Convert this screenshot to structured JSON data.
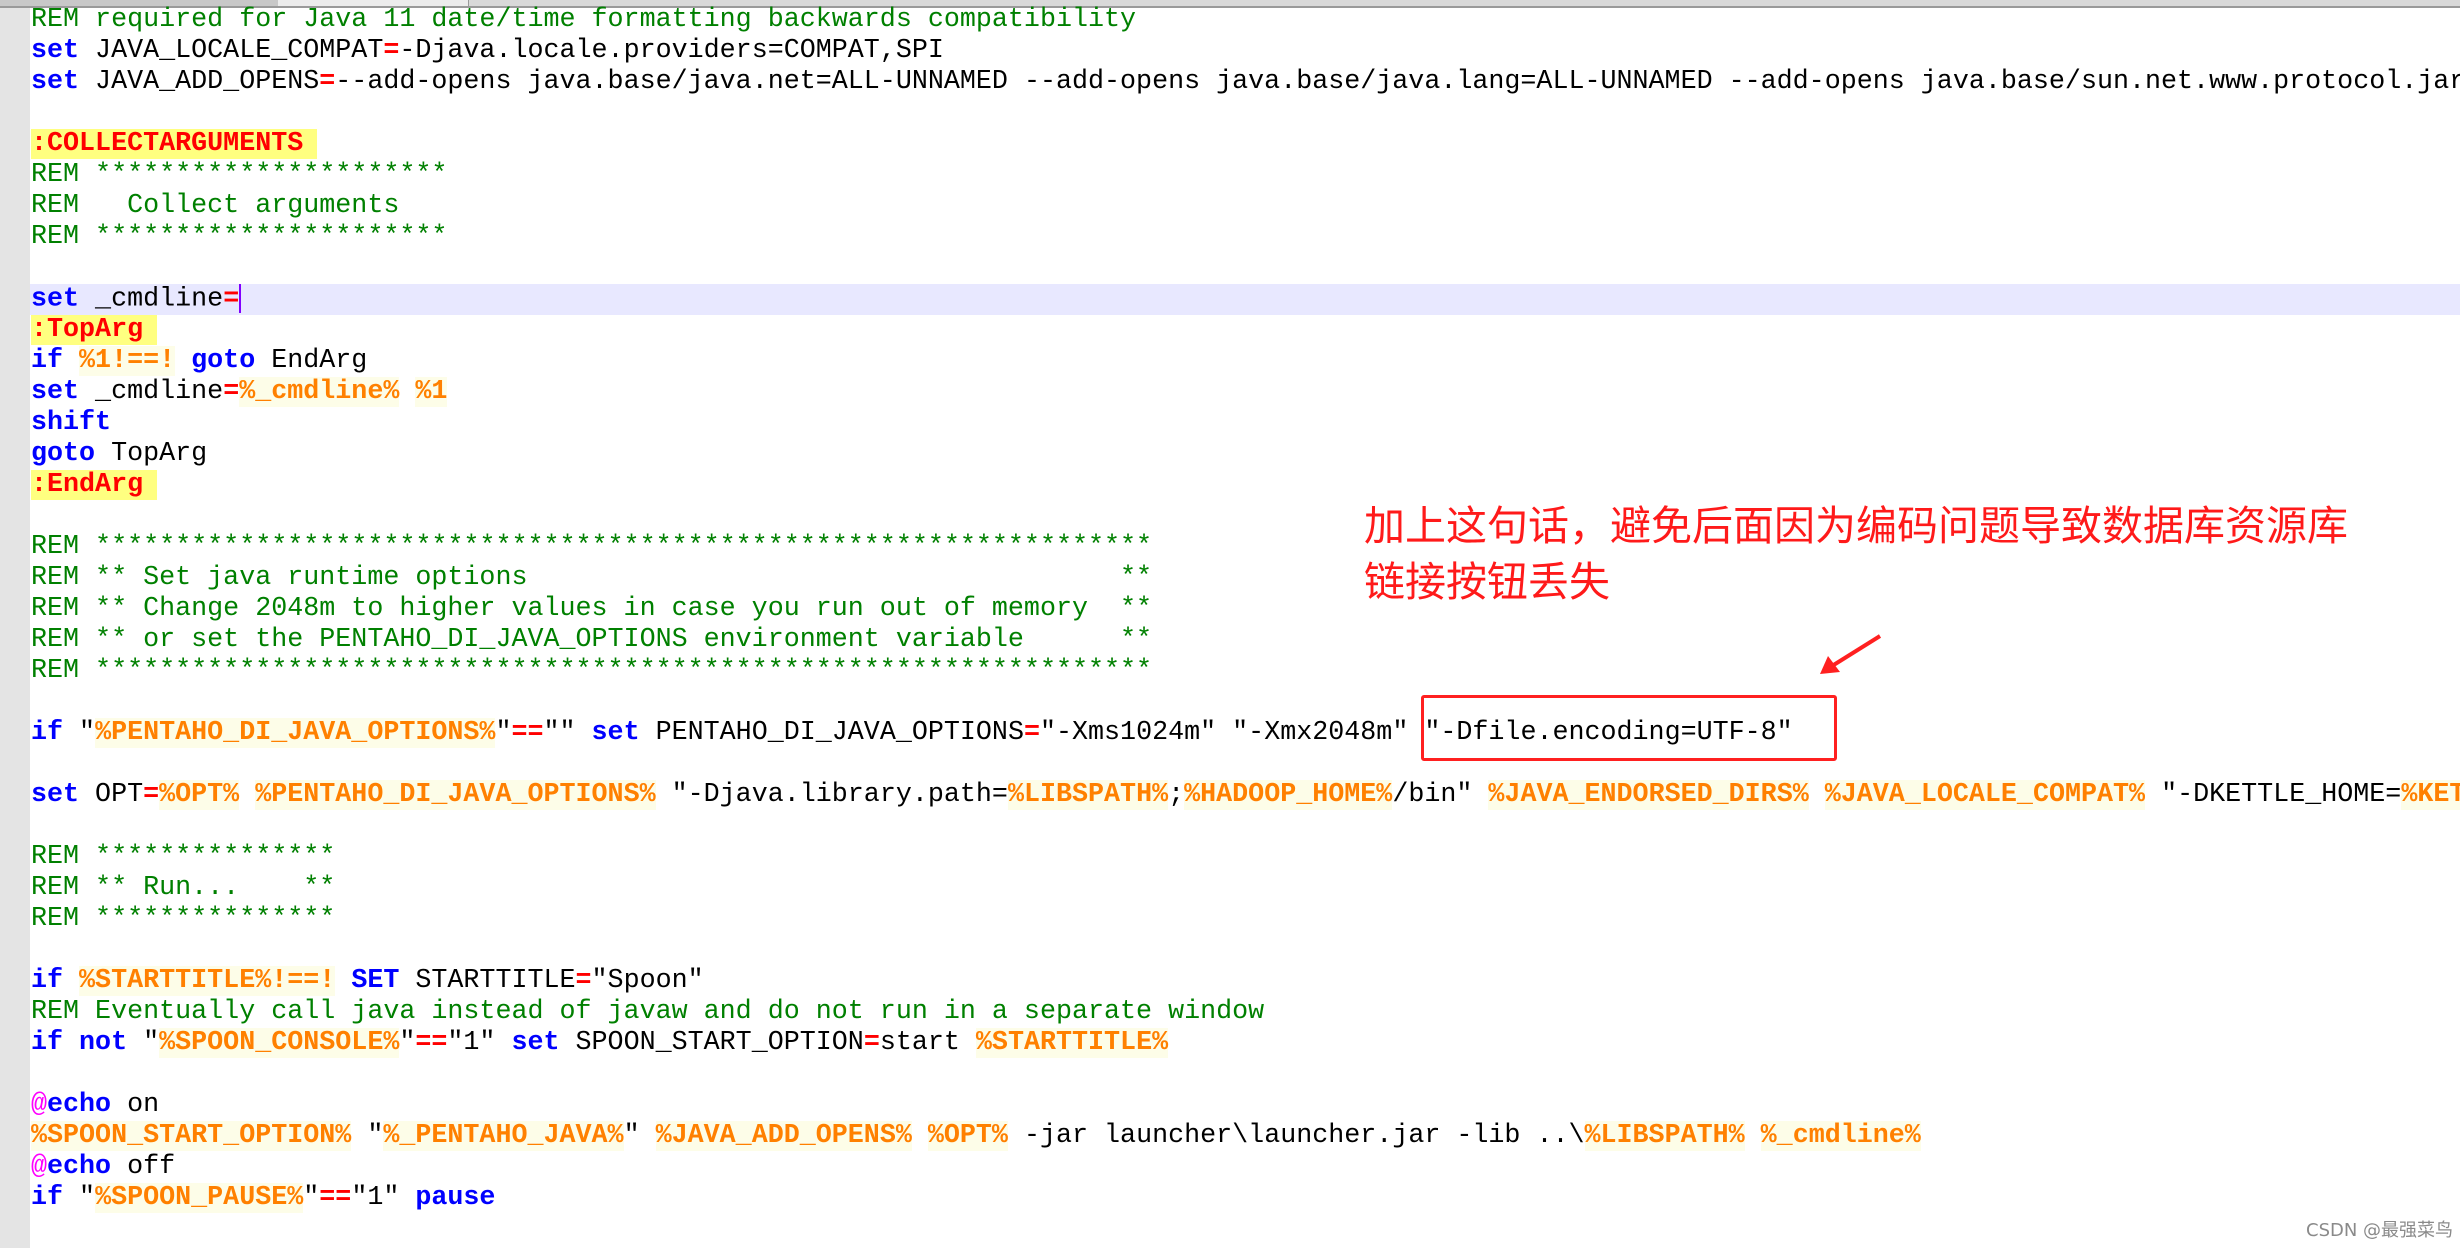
{
  "colors": {
    "comment": "#008000",
    "keyword": "#0000ff",
    "operator": "#ff0000",
    "variable": "#ff8000",
    "label": "#ff0000",
    "label_bg": "#ffff80",
    "current_line_bg": "#e8e8ff",
    "annotation": "#ff1a1a"
  },
  "editor": {
    "current_line": 9,
    "lines": [
      {
        "tokens": [
          {
            "t": "c",
            "s": "REM required for Java 11 date/time formatting backwards compatibility"
          }
        ]
      },
      {
        "tokens": [
          {
            "t": "k",
            "s": "set"
          },
          {
            "t": "t",
            "s": " JAVA_LOCALE_COMPAT"
          },
          {
            "t": "o",
            "s": "="
          },
          {
            "t": "t",
            "s": "-Djava.locale.providers=COMPAT,SPI"
          }
        ]
      },
      {
        "tokens": [
          {
            "t": "k",
            "s": "set"
          },
          {
            "t": "t",
            "s": " JAVA_ADD_OPENS"
          },
          {
            "t": "o",
            "s": "="
          },
          {
            "t": "t",
            "s": "--add-opens java.base/java.net=ALL-UNNAMED --add-opens java.base/java.lang=ALL-UNNAMED --add-opens java.base/sun.net.www.protocol.jar"
          }
        ]
      },
      {
        "tokens": []
      },
      {
        "tokens": [
          {
            "t": "l",
            "s": ":COLLECTARGUMENTS"
          }
        ]
      },
      {
        "tokens": [
          {
            "t": "c",
            "s": "REM **********************"
          }
        ]
      },
      {
        "tokens": [
          {
            "t": "c",
            "s": "REM   Collect arguments"
          }
        ]
      },
      {
        "tokens": [
          {
            "t": "c",
            "s": "REM **********************"
          }
        ]
      },
      {
        "tokens": []
      },
      {
        "tokens": [
          {
            "t": "k",
            "s": "set"
          },
          {
            "t": "t",
            "s": " _cmdline"
          },
          {
            "t": "o",
            "s": "="
          }
        ]
      },
      {
        "tokens": [
          {
            "t": "l",
            "s": ":TopArg"
          }
        ]
      },
      {
        "tokens": [
          {
            "t": "k",
            "s": "if"
          },
          {
            "t": "t",
            "s": " "
          },
          {
            "t": "v",
            "s": "%1!==!"
          },
          {
            "t": "t",
            "s": " "
          },
          {
            "t": "k",
            "s": "goto"
          },
          {
            "t": "t",
            "s": " EndArg"
          }
        ]
      },
      {
        "tokens": [
          {
            "t": "k",
            "s": "set"
          },
          {
            "t": "t",
            "s": " _cmdline"
          },
          {
            "t": "o",
            "s": "="
          },
          {
            "t": "v",
            "s": "%_cmdline%"
          },
          {
            "t": "t",
            "s": " "
          },
          {
            "t": "v",
            "s": "%1"
          }
        ]
      },
      {
        "tokens": [
          {
            "t": "k",
            "s": "shift"
          }
        ]
      },
      {
        "tokens": [
          {
            "t": "k",
            "s": "goto"
          },
          {
            "t": "t",
            "s": " TopArg"
          }
        ]
      },
      {
        "tokens": [
          {
            "t": "l",
            "s": ":EndArg"
          }
        ]
      },
      {
        "tokens": []
      },
      {
        "tokens": [
          {
            "t": "c",
            "s": "REM ******************************************************************"
          }
        ]
      },
      {
        "tokens": [
          {
            "t": "c",
            "s": "REM ** Set java runtime options                                     **"
          }
        ]
      },
      {
        "tokens": [
          {
            "t": "c",
            "s": "REM ** Change 2048m to higher values in case you run out of memory  **"
          }
        ]
      },
      {
        "tokens": [
          {
            "t": "c",
            "s": "REM ** or set the PENTAHO_DI_JAVA_OPTIONS environment variable      **"
          }
        ]
      },
      {
        "tokens": [
          {
            "t": "c",
            "s": "REM ******************************************************************"
          }
        ]
      },
      {
        "tokens": []
      },
      {
        "tokens": [
          {
            "t": "k",
            "s": "if"
          },
          {
            "t": "t",
            "s": " \""
          },
          {
            "t": "v",
            "s": "%PENTAHO_DI_JAVA_OPTIONS%"
          },
          {
            "t": "t",
            "s": "\""
          },
          {
            "t": "o",
            "s": "=="
          },
          {
            "t": "t",
            "s": "\"\" "
          },
          {
            "t": "k",
            "s": "set"
          },
          {
            "t": "t",
            "s": " PENTAHO_DI_JAVA_OPTIONS"
          },
          {
            "t": "o",
            "s": "="
          },
          {
            "t": "t",
            "s": "\"-Xms1024m\" \"-Xmx2048m\" \"-Dfile.encoding=UTF-8\""
          }
        ]
      },
      {
        "tokens": []
      },
      {
        "tokens": [
          {
            "t": "k",
            "s": "set"
          },
          {
            "t": "t",
            "s": " OPT"
          },
          {
            "t": "o",
            "s": "="
          },
          {
            "t": "v",
            "s": "%OPT%"
          },
          {
            "t": "t",
            "s": " "
          },
          {
            "t": "v",
            "s": "%PENTAHO_DI_JAVA_OPTIONS%"
          },
          {
            "t": "t",
            "s": " \"-Djava.library.path="
          },
          {
            "t": "v",
            "s": "%LIBSPATH%"
          },
          {
            "t": "t",
            "s": ";"
          },
          {
            "t": "v",
            "s": "%HADOOP_HOME%"
          },
          {
            "t": "t",
            "s": "/bin\" "
          },
          {
            "t": "v",
            "s": "%JAVA_ENDORSED_DIRS%"
          },
          {
            "t": "t",
            "s": " "
          },
          {
            "t": "v",
            "s": "%JAVA_LOCALE_COMPAT%"
          },
          {
            "t": "t",
            "s": " \"-DKETTLE_HOME="
          },
          {
            "t": "v",
            "s": "%KET"
          }
        ]
      },
      {
        "tokens": []
      },
      {
        "tokens": [
          {
            "t": "c",
            "s": "REM ***************"
          }
        ]
      },
      {
        "tokens": [
          {
            "t": "c",
            "s": "REM ** Run...    **"
          }
        ]
      },
      {
        "tokens": [
          {
            "t": "c",
            "s": "REM ***************"
          }
        ]
      },
      {
        "tokens": []
      },
      {
        "tokens": [
          {
            "t": "k",
            "s": "if"
          },
          {
            "t": "t",
            "s": " "
          },
          {
            "t": "v",
            "s": "%STARTTITLE%!==!"
          },
          {
            "t": "t",
            "s": " "
          },
          {
            "t": "k",
            "s": "SET"
          },
          {
            "t": "t",
            "s": " STARTTITLE"
          },
          {
            "t": "o",
            "s": "="
          },
          {
            "t": "t",
            "s": "\"Spoon\""
          }
        ]
      },
      {
        "tokens": [
          {
            "t": "c",
            "s": "REM Eventually call java instead of javaw and do not run in a separate window"
          }
        ]
      },
      {
        "tokens": [
          {
            "t": "k",
            "s": "if"
          },
          {
            "t": "t",
            "s": " "
          },
          {
            "t": "k",
            "s": "not"
          },
          {
            "t": "t",
            "s": " \""
          },
          {
            "t": "v",
            "s": "%SPOON_CONSOLE%"
          },
          {
            "t": "t",
            "s": "\""
          },
          {
            "t": "o",
            "s": "=="
          },
          {
            "t": "t",
            "s": "\"1\" "
          },
          {
            "t": "k",
            "s": "set"
          },
          {
            "t": "t",
            "s": " SPOON_START_OPTION"
          },
          {
            "t": "o",
            "s": "="
          },
          {
            "t": "t",
            "s": "start "
          },
          {
            "t": "v",
            "s": "%STARTTITLE%"
          }
        ]
      },
      {
        "tokens": []
      },
      {
        "tokens": [
          {
            "t": "a",
            "s": "@"
          },
          {
            "t": "k",
            "s": "echo"
          },
          {
            "t": "t",
            "s": " on"
          }
        ]
      },
      {
        "tokens": [
          {
            "t": "v",
            "s": "%SPOON_START_OPTION%"
          },
          {
            "t": "t",
            "s": " \""
          },
          {
            "t": "v",
            "s": "%_PENTAHO_JAVA%"
          },
          {
            "t": "t",
            "s": "\" "
          },
          {
            "t": "v",
            "s": "%JAVA_ADD_OPENS%"
          },
          {
            "t": "t",
            "s": " "
          },
          {
            "t": "v",
            "s": "%OPT%"
          },
          {
            "t": "t",
            "s": " -jar launcher\\launcher.jar -lib ..\\"
          },
          {
            "t": "v",
            "s": "%LIBSPATH%"
          },
          {
            "t": "t",
            "s": " "
          },
          {
            "t": "v",
            "s": "%_cmdline%"
          }
        ]
      },
      {
        "tokens": [
          {
            "t": "a",
            "s": "@"
          },
          {
            "t": "k",
            "s": "echo"
          },
          {
            "t": "t",
            "s": " off"
          }
        ]
      },
      {
        "tokens": [
          {
            "t": "k",
            "s": "if"
          },
          {
            "t": "t",
            "s": " \""
          },
          {
            "t": "v",
            "s": "%SPOON_PAUSE%"
          },
          {
            "t": "t",
            "s": "\""
          },
          {
            "t": "o",
            "s": "=="
          },
          {
            "t": "t",
            "s": "\"1\" "
          },
          {
            "t": "k",
            "s": "pause"
          }
        ]
      }
    ]
  },
  "annotation": {
    "line1": "加上这句话，避免后面因为编码问题导致数据库资源库",
    "line2": "链接按钮丢失",
    "highlight_box_icon": "red-rectangle",
    "arrow_icon": "red-arrow"
  },
  "watermark": "CSDN @最强菜鸟"
}
